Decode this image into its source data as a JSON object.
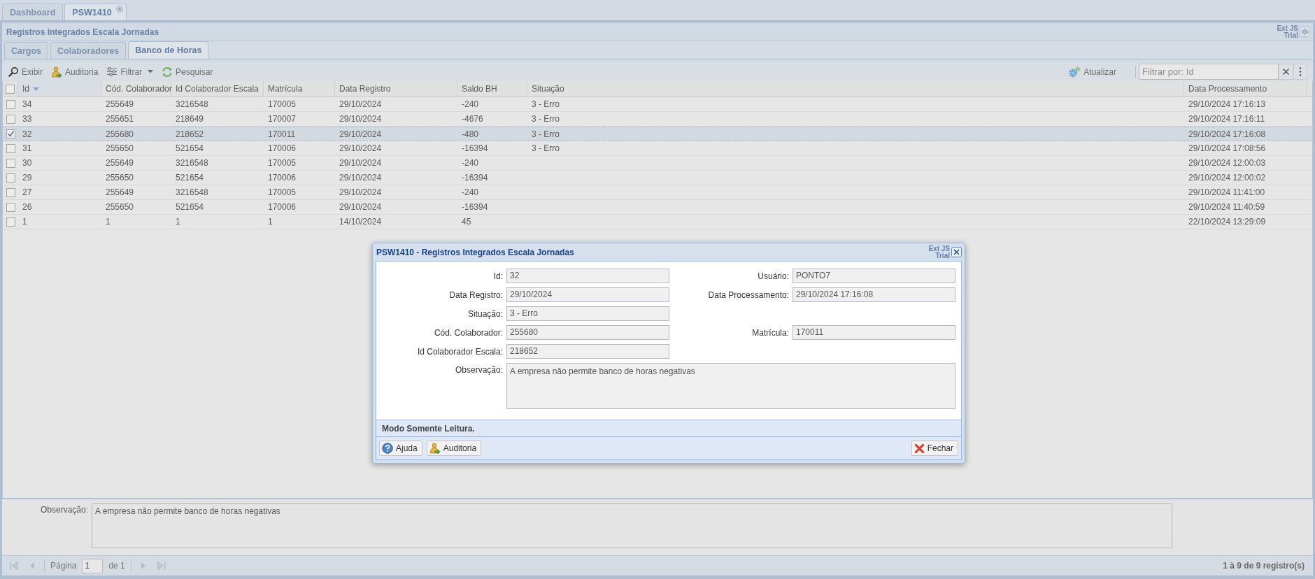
{
  "tabs": [
    {
      "label": "Dashboard",
      "selected": false,
      "closable": false
    },
    {
      "label": "PSW1410",
      "selected": true,
      "closable": true
    }
  ],
  "panel": {
    "title": "Registros Integrados Escala Jornadas",
    "trial_badge": "Ext JS Trial"
  },
  "subtabs": [
    {
      "label": "Cargos",
      "selected": false
    },
    {
      "label": "Colaboradores",
      "selected": false
    },
    {
      "label": "Banco de Horas",
      "selected": true
    }
  ],
  "toolbar": {
    "items": [
      {
        "label": "Exibir",
        "kind": "view",
        "menu": false
      },
      {
        "label": "Auditoria",
        "kind": "audit",
        "menu": false
      },
      {
        "label": "Filtrar",
        "kind": "filter",
        "menu": true
      },
      {
        "label": "Pesquisar",
        "kind": "search",
        "menu": false
      }
    ],
    "refresh": {
      "label": "Atualizar"
    },
    "filter": {
      "placeholder": "Filtrar por: Id"
    }
  },
  "grid": {
    "select_all": false,
    "columns": [
      {
        "label": "Id",
        "descending": true
      },
      {
        "label": "Cód. Colaborador"
      },
      {
        "label": "Id Colaborador Escala"
      },
      {
        "label": "Matrícula"
      },
      {
        "label": "Data Registro"
      },
      {
        "label": "Saldo BH"
      },
      {
        "label": "Situação"
      },
      {
        "label": "Data Processamento"
      }
    ],
    "rows": [
      {
        "selected": false,
        "id": "34",
        "cod_colaborador": "255649",
        "id_colaborador_escala": "3216548",
        "matricula": "170005",
        "data_registro": "29/10/2024",
        "saldo_bh": "-240",
        "situacao": "3 - Erro",
        "data_processamento": "29/10/2024 17:16:13"
      },
      {
        "selected": false,
        "id": "33",
        "cod_colaborador": "255651",
        "id_colaborador_escala": "218649",
        "matricula": "170007",
        "data_registro": "29/10/2024",
        "saldo_bh": "-4676",
        "situacao": "3 - Erro",
        "data_processamento": "29/10/2024 17:16:11"
      },
      {
        "selected": true,
        "id": "32",
        "cod_colaborador": "255680",
        "id_colaborador_escala": "218652",
        "matricula": "170011",
        "data_registro": "29/10/2024",
        "saldo_bh": "-480",
        "situacao": "3 - Erro",
        "data_processamento": "29/10/2024 17:16:08"
      },
      {
        "selected": false,
        "id": "31",
        "cod_colaborador": "255650",
        "id_colaborador_escala": "521654",
        "matricula": "170006",
        "data_registro": "29/10/2024",
        "saldo_bh": "-16394",
        "situacao": "3 - Erro",
        "data_processamento": "29/10/2024 17:08:56"
      },
      {
        "selected": false,
        "id": "30",
        "cod_colaborador": "255649",
        "id_colaborador_escala": "3216548",
        "matricula": "170005",
        "data_registro": "29/10/2024",
        "saldo_bh": "-240",
        "data_processamento": "29/10/2024 12:00:03"
      },
      {
        "selected": false,
        "id": "29",
        "cod_colaborador": "255650",
        "id_colaborador_escala": "521654",
        "matricula": "170006",
        "data_registro": "29/10/2024",
        "saldo_bh": "-16394",
        "data_processamento": "29/10/2024 12:00:02"
      },
      {
        "selected": false,
        "id": "27",
        "cod_colaborador": "255649",
        "id_colaborador_escala": "3216548",
        "matricula": "170005",
        "data_registro": "29/10/2024",
        "saldo_bh": "-240",
        "data_processamento": "29/10/2024 11:41:00"
      },
      {
        "selected": false,
        "id": "26",
        "cod_colaborador": "255650",
        "id_colaborador_escala": "521654",
        "matricula": "170006",
        "data_registro": "29/10/2024",
        "saldo_bh": "-16394",
        "data_processamento": "29/10/2024 11:40:59"
      },
      {
        "selected": false,
        "id": "1",
        "cod_colaborador": "1",
        "id_colaborador_escala": "1",
        "matricula": "1",
        "data_registro": "14/10/2024",
        "saldo_bh": "45",
        "data_processamento": "22/10/2024 13:29:09"
      }
    ]
  },
  "detail": {
    "label": "Observação:",
    "value": "A empresa não permite banco de horas negativas"
  },
  "paging": {
    "nav": [
      {
        "kind": "first",
        "disabled": true
      },
      {
        "kind": "prev",
        "disabled": true
      },
      {
        "kind": "next",
        "disabled": true
      },
      {
        "kind": "last",
        "disabled": true
      }
    ],
    "page_label": "Página",
    "page": "1",
    "page_count": "de 1",
    "summary": "1 à 9 de 9 registro(s)"
  },
  "dialog": {
    "title": "PSW1410 - Registros Integrados Escala Jornadas",
    "trial_badge": "Ext JS Trial",
    "rows": [
      {
        "fields": [
          {
            "label": "Id:",
            "value": "32"
          },
          {
            "label": "Usuário:",
            "value": "PONTO7"
          }
        ]
      },
      {
        "fields": [
          {
            "label": "Data Registro:",
            "value": "29/10/2024"
          },
          {
            "label": "Data Processamento:",
            "value": "29/10/2024 17:16:08"
          }
        ]
      },
      {
        "fields": [
          {
            "label": "Situação:",
            "value": "3 - Erro"
          }
        ]
      },
      {
        "fields": [
          {
            "label": "Cód. Colaborador:",
            "value": "255680"
          },
          {
            "label": "Matrícula:",
            "value": "170011"
          }
        ]
      },
      {
        "fields": [
          {
            "label": "Id Colaborador Escala:",
            "value": "218652"
          }
        ]
      }
    ],
    "note": {
      "label": "Observação:",
      "value": "A empresa não permite banco de horas negativas"
    },
    "status": "Modo Somente Leitura.",
    "buttons": [
      {
        "label": "Ajuda",
        "kind": "help"
      },
      {
        "label": "Auditoria",
        "kind": "audit"
      },
      {
        "label": "Fechar",
        "kind": "close"
      }
    ]
  }
}
